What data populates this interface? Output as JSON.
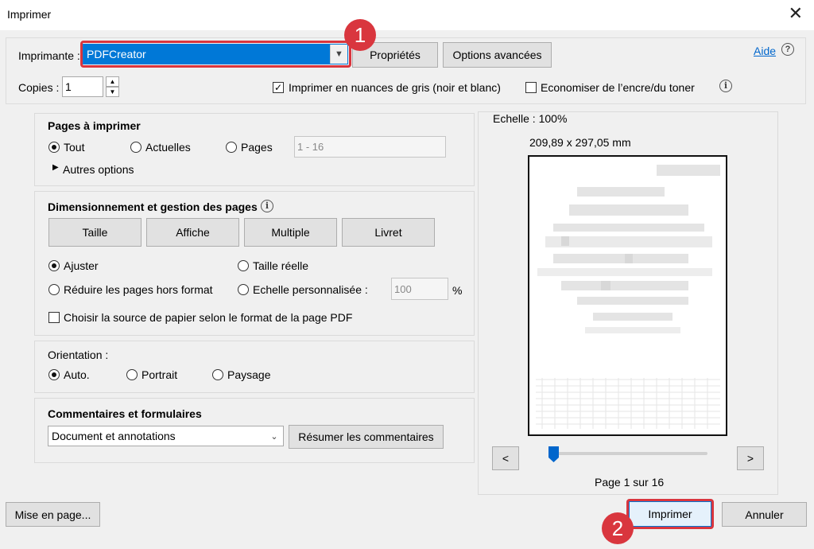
{
  "window": {
    "title": "Imprimer",
    "close_glyph": "✕"
  },
  "printer": {
    "label": "Imprimante :",
    "selected": "PDFCreator",
    "properties_button": "Propriétés",
    "advanced_button": "Options avancées",
    "help_link": "Aide",
    "help_glyph": "?"
  },
  "copies": {
    "label": "Copies :",
    "value": "1",
    "grayscale_label": "Imprimer en nuances de gris (noir et blanc)",
    "grayscale_checked": true,
    "save_ink_label": "Economiser de l’encre/du toner",
    "save_ink_checked": false,
    "info_glyph": "i"
  },
  "pages_section": {
    "title": "Pages à imprimer",
    "options": [
      "Tout",
      "Actuelles",
      "Pages"
    ],
    "selected": "Tout",
    "range_value": "1 - 16",
    "more_options": "Autres options"
  },
  "sizing_section": {
    "title": "Dimensionnement et gestion des pages",
    "buttons": [
      "Taille",
      "Affiche",
      "Multiple",
      "Livret"
    ],
    "fit_label": "Ajuster",
    "actual_size_label": "Taille réelle",
    "shrink_label": "Réduire les pages hors format",
    "custom_scale_label": "Echelle personnalisée :",
    "custom_scale_value": "100",
    "percent_sign": "%",
    "paper_source_label": "Choisir la source de papier selon le format de la page PDF",
    "selected": "Ajuster"
  },
  "orientation_section": {
    "title": "Orientation :",
    "options": [
      "Auto.",
      "Portrait",
      "Paysage"
    ],
    "selected": "Auto."
  },
  "comments_section": {
    "title": "Commentaires et formulaires",
    "selected": "Document et annotations",
    "summarize_button": "Résumer les commentaires"
  },
  "preview": {
    "scale": "Echelle : 100%",
    "dimensions": "209,89 x 297,05 mm",
    "prev": "<",
    "next": ">",
    "page_info": "Page 1 sur 16",
    "slider_position": 0.0
  },
  "footer": {
    "page_setup": "Mise en page...",
    "print": "Imprimer",
    "cancel": "Annuler"
  },
  "annotations": {
    "badge_1": "1",
    "badge_2": "2",
    "accent": "#d9363e"
  }
}
